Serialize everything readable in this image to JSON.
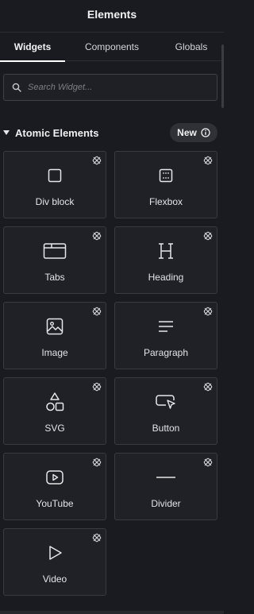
{
  "header": {
    "title": "Elements"
  },
  "tabs": [
    {
      "label": "Widgets",
      "active": true
    },
    {
      "label": "Components",
      "active": false
    },
    {
      "label": "Globals",
      "active": false
    }
  ],
  "search": {
    "placeholder": "Search Widget...",
    "value": "",
    "icon": "search-icon"
  },
  "section": {
    "title": "Atomic Elements",
    "badge": "New",
    "badge_icon": "info-icon",
    "expanded": true
  },
  "widgets": [
    {
      "label": "Div block",
      "icon": "div-block-icon"
    },
    {
      "label": "Flexbox",
      "icon": "flexbox-icon"
    },
    {
      "label": "Tabs",
      "icon": "tabs-icon"
    },
    {
      "label": "Heading",
      "icon": "heading-icon"
    },
    {
      "label": "Image",
      "icon": "image-icon"
    },
    {
      "label": "Paragraph",
      "icon": "paragraph-icon"
    },
    {
      "label": "SVG",
      "icon": "svg-shapes-icon"
    },
    {
      "label": "Button",
      "icon": "button-icon"
    },
    {
      "label": "YouTube",
      "icon": "youtube-icon"
    },
    {
      "label": "Divider",
      "icon": "divider-icon"
    },
    {
      "label": "Video",
      "icon": "video-icon"
    }
  ],
  "colors": {
    "background": "#191b20",
    "card": "#1f2126",
    "card_border": "#393b41",
    "text": "#e3e4e6"
  }
}
